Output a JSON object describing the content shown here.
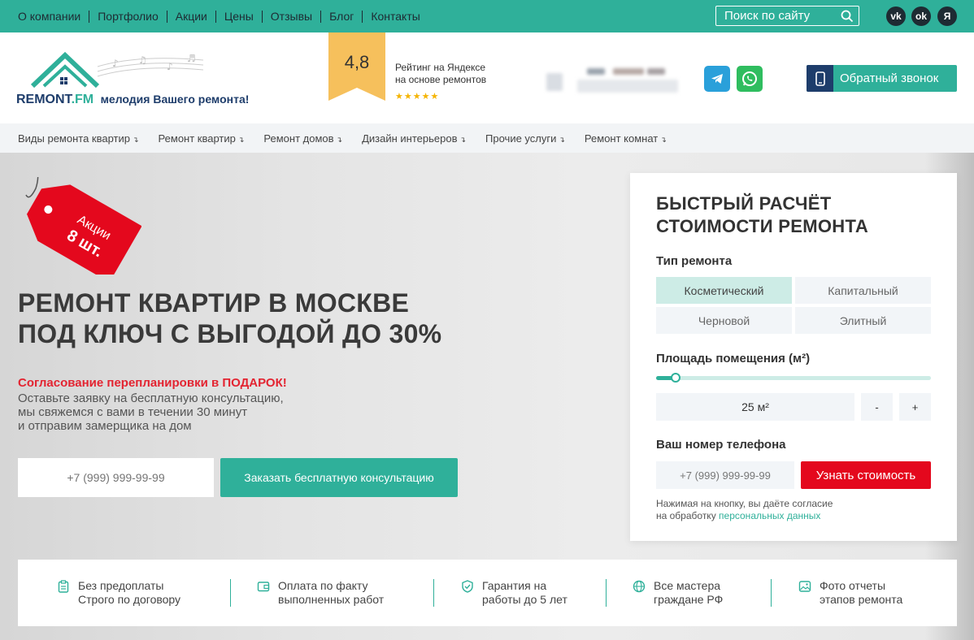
{
  "topnav": [
    "О компании",
    "Портфолио",
    "Акции",
    "Цены",
    "Отзывы",
    "Блог",
    "Контакты"
  ],
  "search": {
    "label": "Поиск по сайту"
  },
  "social": {
    "vk": "vk",
    "ok": "ok",
    "ya": "Я"
  },
  "logo": {
    "brand": "REMONT",
    "brand_suffix": ".FM",
    "tagline": "мелодия Вашего ремонта!"
  },
  "rating": {
    "value": "4,8",
    "line1": "Рейтинг на Яндексе",
    "line2": "на основе ремонтов",
    "stars": "★★★★★"
  },
  "callback": {
    "label": "Обратный звонок"
  },
  "subnav": [
    "Виды ремонта квартир",
    "Ремонт квартир",
    "Ремонт домов",
    "Дизайн интерьеров",
    "Прочие услуги",
    "Ремонт комнат"
  ],
  "promo_tag": {
    "line1": "Акции",
    "line2": "8 шт."
  },
  "hero": {
    "title_line1": "РЕМОНТ КВАРТИР В МОСКВЕ",
    "title_line2": "ПОД КЛЮЧ С ВЫГОДОЙ ДО 30%",
    "promo": "Согласование перепланировки в ПОДАРОК!",
    "sub": "Оставьте заявку на бесплатную консультацию,\nмы свяжемся с вами в течении 30 минут\nи отправим замерщика на дом",
    "phone_placeholder": "+7 (999) 999-99-99",
    "cta": "Заказать бесплатную консультацию"
  },
  "calc": {
    "title_line1": "БЫСТРЫЙ РАСЧЁТ",
    "title_line2": "СТОИМОСТИ РЕМОНТА",
    "type_label": "Тип ремонта",
    "types": [
      "Косметический",
      "Капитальный",
      "Черновой",
      "Элитный"
    ],
    "selected_type": "Косметический",
    "area_label": "Площадь помещения (м²)",
    "area_value": "25 м²",
    "area_fraction": 0.07,
    "minus": "-",
    "plus": "+",
    "phone_label": "Ваш номер телефона",
    "phone_placeholder": "+7 (999) 999-99-99",
    "submit": "Узнать стоимость",
    "note_line1": "Нажимая на кнопку, вы даёте согласие",
    "note_line2_prefix": "на обработку ",
    "note_link": "персональных данных"
  },
  "features": [
    {
      "line1": "Без предоплаты",
      "line2": "Строго по договору"
    },
    {
      "line1": "Оплата по факту",
      "line2": "выполненных работ"
    },
    {
      "line1": "Гарантия на",
      "line2": "работы до 5 лет"
    },
    {
      "line1": "Все мастера",
      "line2": "граждане РФ"
    },
    {
      "line1": "Фото отчеты",
      "line2": "этапов ремонта"
    }
  ],
  "colors": {
    "accent": "#2fb09a",
    "dark": "#1e3d6b",
    "red": "#e4081d",
    "star": "#f5b400"
  }
}
